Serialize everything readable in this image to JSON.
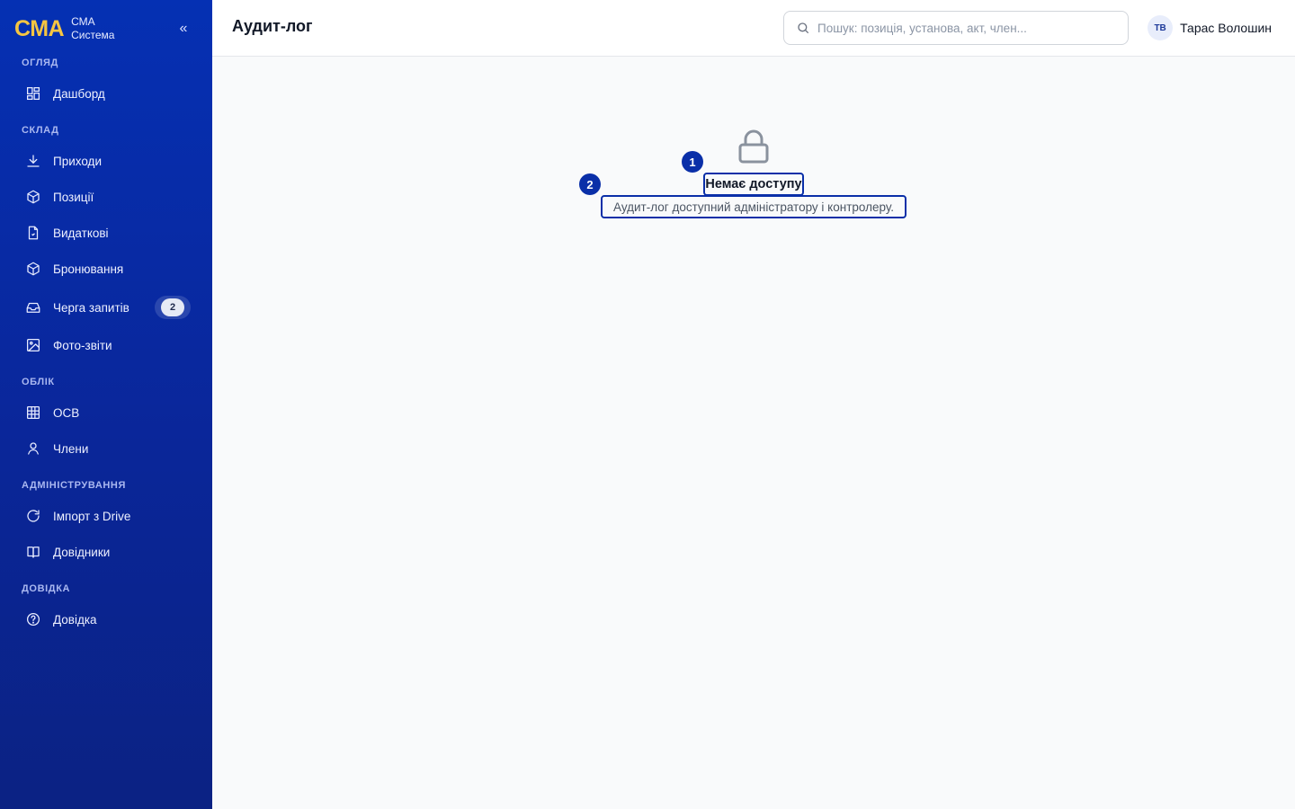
{
  "brand": {
    "logo": "СМА",
    "line1": "СМА",
    "line2": "Система"
  },
  "sidebar": {
    "collapse_icon": "«",
    "sections": [
      {
        "label": "Огляд"
      },
      {
        "label": "Склад"
      },
      {
        "label": "Облік"
      },
      {
        "label": "Адміністрування"
      },
      {
        "label": "Довідка"
      }
    ],
    "items": [
      {
        "label": "Дашборд",
        "icon": "dashboard-icon"
      },
      {
        "label": "Приходи",
        "icon": "download-icon"
      },
      {
        "label": "Позиції",
        "icon": "box-icon"
      },
      {
        "label": "Видаткові",
        "icon": "document-icon"
      },
      {
        "label": "Бронювання",
        "icon": "box-icon"
      },
      {
        "label": "Черга запитів",
        "icon": "inbox-icon",
        "badge": "2"
      },
      {
        "label": "Фото-звіти",
        "icon": "image-icon"
      },
      {
        "label": "ОСВ",
        "icon": "table-icon"
      },
      {
        "label": "Члени",
        "icon": "user-icon"
      },
      {
        "label": "Імпорт з Drive",
        "icon": "refresh-icon"
      },
      {
        "label": "Довідники",
        "icon": "book-icon"
      },
      {
        "label": "Довідка",
        "icon": "help-icon"
      }
    ]
  },
  "header": {
    "title": "Аудит-лог",
    "search_placeholder": "Пошук: позиція, установа, акт, член...",
    "user_initials": "ТВ",
    "user_name": "Тарас Волошин"
  },
  "main": {
    "icon": "lock-icon",
    "markers": [
      "1",
      "2"
    ],
    "title": "Немає доступу",
    "description": "Аудит-лог доступний адміністратору і контролеру."
  },
  "colors": {
    "sidebar_top": "#0530b3",
    "sidebar_bottom": "#0b2283",
    "accent": "#0a2fa8",
    "brand_logo": "#f5c542"
  }
}
